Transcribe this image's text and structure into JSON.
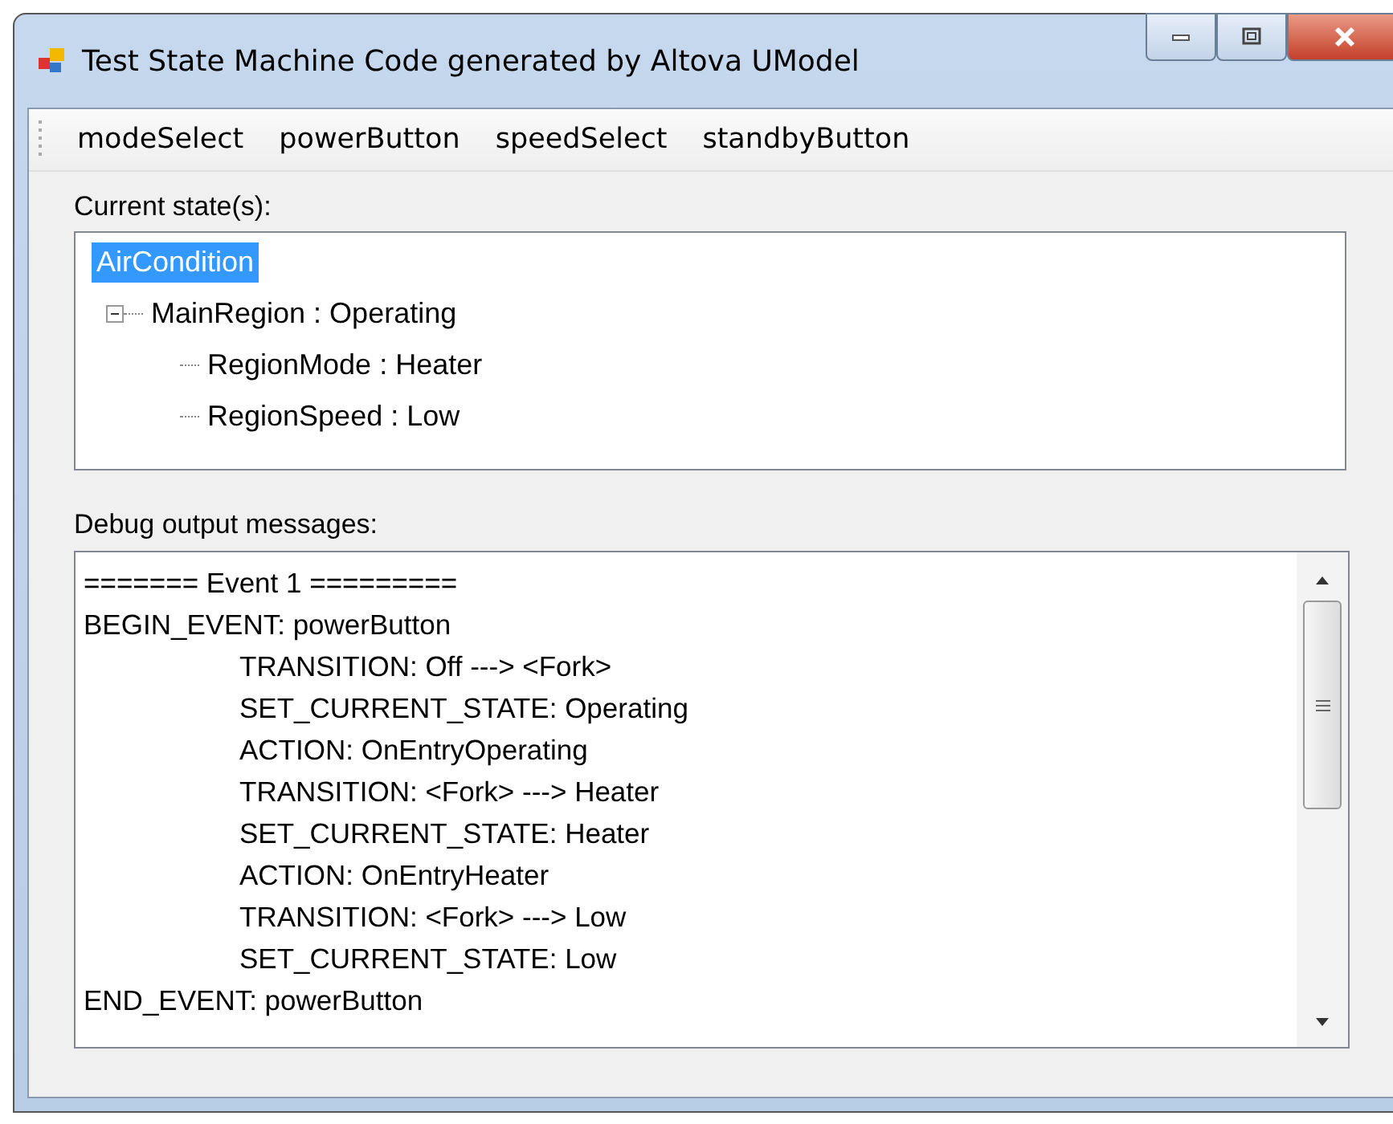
{
  "window": {
    "title": "Test State Machine Code generated by Altova UModel"
  },
  "menu": [
    "modeSelect",
    "powerButton",
    "speedSelect",
    "standbyButton"
  ],
  "states": {
    "label": "Current state(s):",
    "tree": [
      {
        "text": "AirCondition",
        "selected": true,
        "children": [
          {
            "text": "MainRegion : Operating",
            "selected": false,
            "expanded": true,
            "children": [
              {
                "text": "RegionMode : Heater",
                "selected": false
              },
              {
                "text": "RegionSpeed : Low",
                "selected": false
              }
            ]
          }
        ]
      }
    ]
  },
  "debug": {
    "label": "Debug output messages:",
    "lines": [
      {
        "text": "======= Event 1 =========",
        "indent": false
      },
      {
        "text": "BEGIN_EVENT: powerButton",
        "indent": false
      },
      {
        "text": "TRANSITION: Off ---> <Fork>",
        "indent": true
      },
      {
        "text": "SET_CURRENT_STATE: Operating",
        "indent": true
      },
      {
        "text": "ACTION: OnEntryOperating",
        "indent": true
      },
      {
        "text": "TRANSITION: <Fork> ---> Heater",
        "indent": true
      },
      {
        "text": "SET_CURRENT_STATE: Heater",
        "indent": true
      },
      {
        "text": "ACTION: OnEntryHeater",
        "indent": true
      },
      {
        "text": "TRANSITION: <Fork> ---> Low",
        "indent": true
      },
      {
        "text": "SET_CURRENT_STATE: Low",
        "indent": true
      },
      {
        "text": "END_EVENT: powerButton",
        "indent": false
      }
    ]
  }
}
